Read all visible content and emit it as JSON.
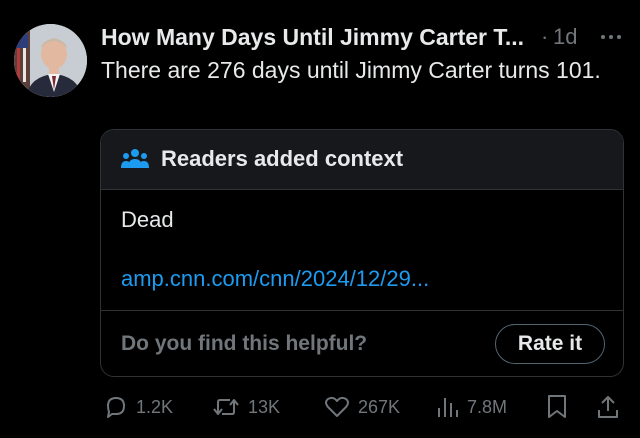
{
  "post": {
    "author_name": "How Many Days Until Jimmy Carter T...",
    "separator": "·",
    "timestamp": "1d",
    "text": "There are 276 days until Jimmy Carter turns 101."
  },
  "note": {
    "title": "Readers added context",
    "body": "Dead",
    "link": "amp.cnn.com/cnn/2024/12/29...",
    "helpful_prompt": "Do you find this helpful?",
    "rate_button_label": "Rate it"
  },
  "actions": {
    "replies": "1.2K",
    "reposts": "13K",
    "likes": "267K",
    "views": "7.8M"
  },
  "icons": {
    "more": "more-dots-icon",
    "note": "people-icon",
    "reply": "reply-bubble-icon",
    "repost": "repost-arrows-icon",
    "like": "heart-icon",
    "views": "bar-chart-icon",
    "bookmark": "bookmark-icon",
    "share": "share-upload-icon"
  },
  "colors": {
    "background": "#000000",
    "text": "#e7e9ea",
    "muted": "#71767b",
    "link": "#1d9bf0",
    "border": "#2f3336",
    "note_header_bg": "#16181c"
  }
}
